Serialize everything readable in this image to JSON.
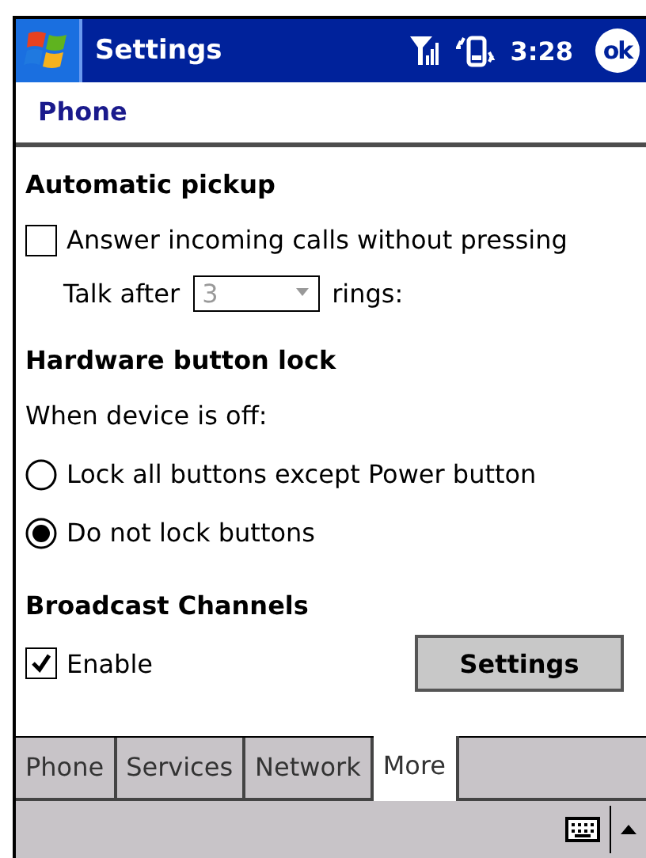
{
  "title_bar": {
    "title": "Settings",
    "time": "3:28",
    "ok": "ok"
  },
  "page_title": "Phone",
  "sections": [
    {
      "heading": "Automatic pickup",
      "items": [
        {
          "kind": "checkbox",
          "label": "Answer incoming calls without pressing",
          "checked": false
        },
        {
          "kind": "dropdown",
          "before": "Talk after",
          "value": "3",
          "after": "rings:",
          "disabled": true
        }
      ]
    },
    {
      "heading": "Hardware button lock",
      "items": [
        {
          "kind": "text",
          "label": "When device is off:"
        },
        {
          "kind": "radio",
          "label": "Lock all buttons except Power button",
          "selected": false
        },
        {
          "kind": "radio",
          "label": "Do not lock buttons",
          "selected": true
        }
      ]
    },
    {
      "heading": "Broadcast Channels",
      "items": [
        {
          "kind": "checkbox_button",
          "label": "Enable",
          "checked": true,
          "button": "Settings"
        }
      ]
    }
  ],
  "tabs": [
    {
      "label": "Phone",
      "selected": false
    },
    {
      "label": "Services",
      "selected": false
    },
    {
      "label": "Network",
      "selected": false
    },
    {
      "label": "More",
      "selected": true
    }
  ]
}
